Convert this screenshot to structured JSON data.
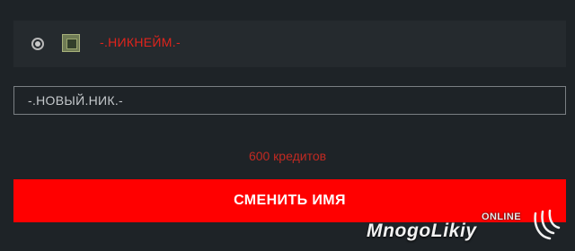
{
  "player": {
    "nickname": "-.НИКНЕЙМ.-"
  },
  "form": {
    "new_nick_value": "-.НОВЫЙ.НИК.-"
  },
  "price": {
    "label": "600 кредитов"
  },
  "actions": {
    "change_name_label": "СМЕНИТЬ ИМЯ"
  },
  "watermark": {
    "online": "ONLINE",
    "name": "MnogoLikiy"
  },
  "colors": {
    "background": "#1e2327",
    "row_background": "#252a2e",
    "accent_red": "#ff0000",
    "nickname_red": "#e0241c",
    "price_red": "#c22a22",
    "input_border": "#7a7f83"
  },
  "icons": {
    "radio": "radio-selected-icon",
    "rank": "rank-badge-icon",
    "watermark_logo": "swoosh-logo-icon"
  }
}
